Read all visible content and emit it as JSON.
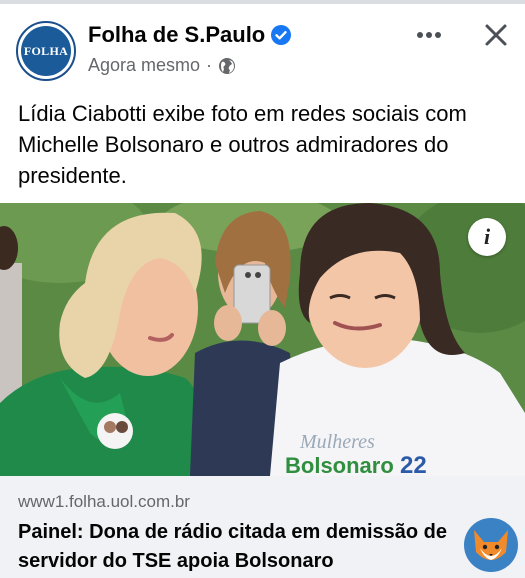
{
  "header": {
    "avatar_text": "FOLHA",
    "page_name": "Folha de S.Paulo",
    "timestamp": "Agora mesmo",
    "separator": "·",
    "more_label": "•••",
    "close_label": "✕"
  },
  "post": {
    "text": "Lídia Ciabotti exibe foto em redes sociais com Michelle Bolsonaro e outros admiradores do presidente."
  },
  "photo": {
    "shirt_script": "Mulheres",
    "shirt_name": "Bolsonaro",
    "info_label": "i"
  },
  "link": {
    "domain": "www1.folha.uol.com.br",
    "title": "Painel: Dona de rádio citada em demissão de servidor do TSE apoia Bolsonaro"
  },
  "colors": {
    "accent": "#1877f2",
    "brand": "#1c5b99",
    "muted": "#65676b",
    "link_bg": "#f0f2f5"
  },
  "icons": [
    "verified-badge-icon",
    "globe-icon",
    "more-icon",
    "close-icon",
    "info-icon",
    "fox-avatar-icon"
  ]
}
